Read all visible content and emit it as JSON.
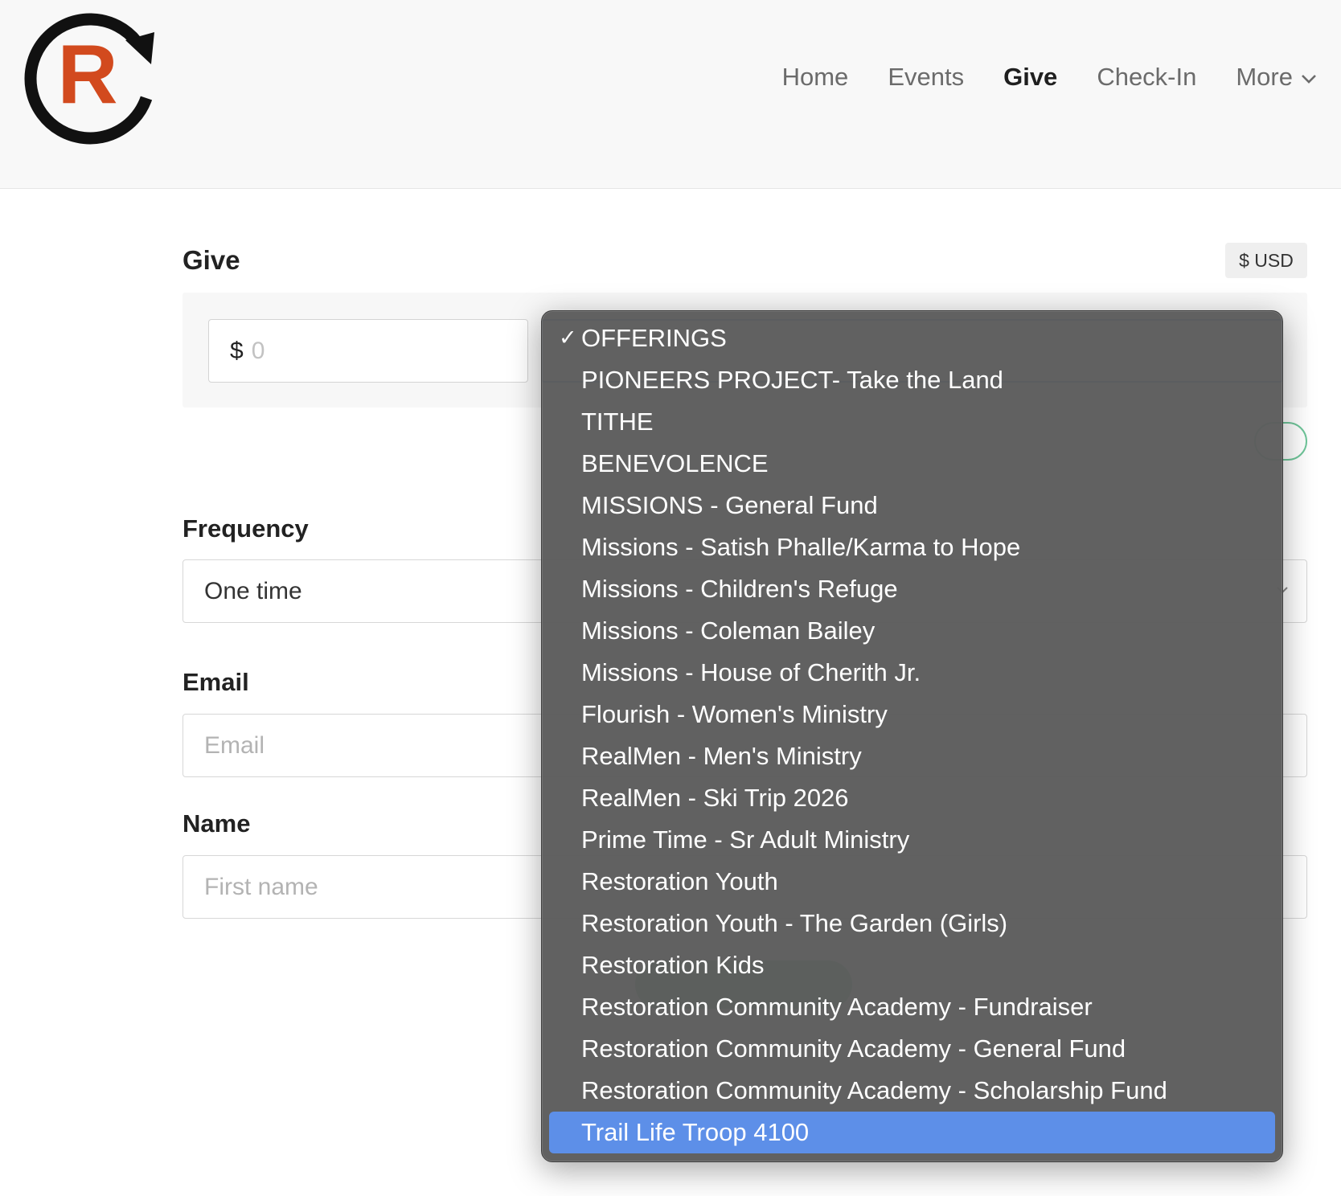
{
  "nav": {
    "items": [
      {
        "label": "Home",
        "active": false
      },
      {
        "label": "Events",
        "active": false
      },
      {
        "label": "Give",
        "active": true
      },
      {
        "label": "Check-In",
        "active": false
      },
      {
        "label": "More",
        "active": false,
        "icon": "chevron-down-icon"
      }
    ]
  },
  "logo": {
    "letter": "R",
    "accent": "#d24a1e",
    "ring": "#111111"
  },
  "give": {
    "title": "Give",
    "currency": "$ USD",
    "amount": {
      "symbol": "$",
      "placeholder": "0"
    }
  },
  "form": {
    "frequency": {
      "label": "Frequency",
      "value": "One time"
    },
    "email": {
      "label": "Email",
      "placeholder": "Email"
    },
    "name": {
      "label": "Name",
      "placeholder": "First name"
    }
  },
  "fund_dropdown": {
    "selected": "OFFERINGS",
    "highlighted": "Trail Life Troop 4100",
    "options": [
      "OFFERINGS",
      "PIONEERS PROJECT- Take the Land",
      "TITHE",
      "BENEVOLENCE",
      "MISSIONS - General Fund",
      "Missions - Satish Phalle/Karma to Hope",
      "Missions - Children's Refuge",
      "Missions - Coleman Bailey",
      "Missions - House of Cherith Jr.",
      "Flourish - Women's Ministry",
      "RealMen - Men's Ministry",
      "RealMen - Ski Trip 2026",
      "Prime Time - Sr Adult Ministry",
      "Restoration Youth",
      "Restoration Youth - The Garden (Girls)",
      "Restoration Kids",
      "Restoration Community Academy - Fundraiser",
      "Restoration Community Academy - General Fund",
      "Restoration Community Academy - Scholarship Fund",
      "Trail Life Troop 4100"
    ]
  },
  "colors": {
    "highlight": "#5d8fe8",
    "dropdown_bg": "#5c5c5c",
    "focus_border": "#4b7bd8",
    "success": "#3da56b"
  }
}
